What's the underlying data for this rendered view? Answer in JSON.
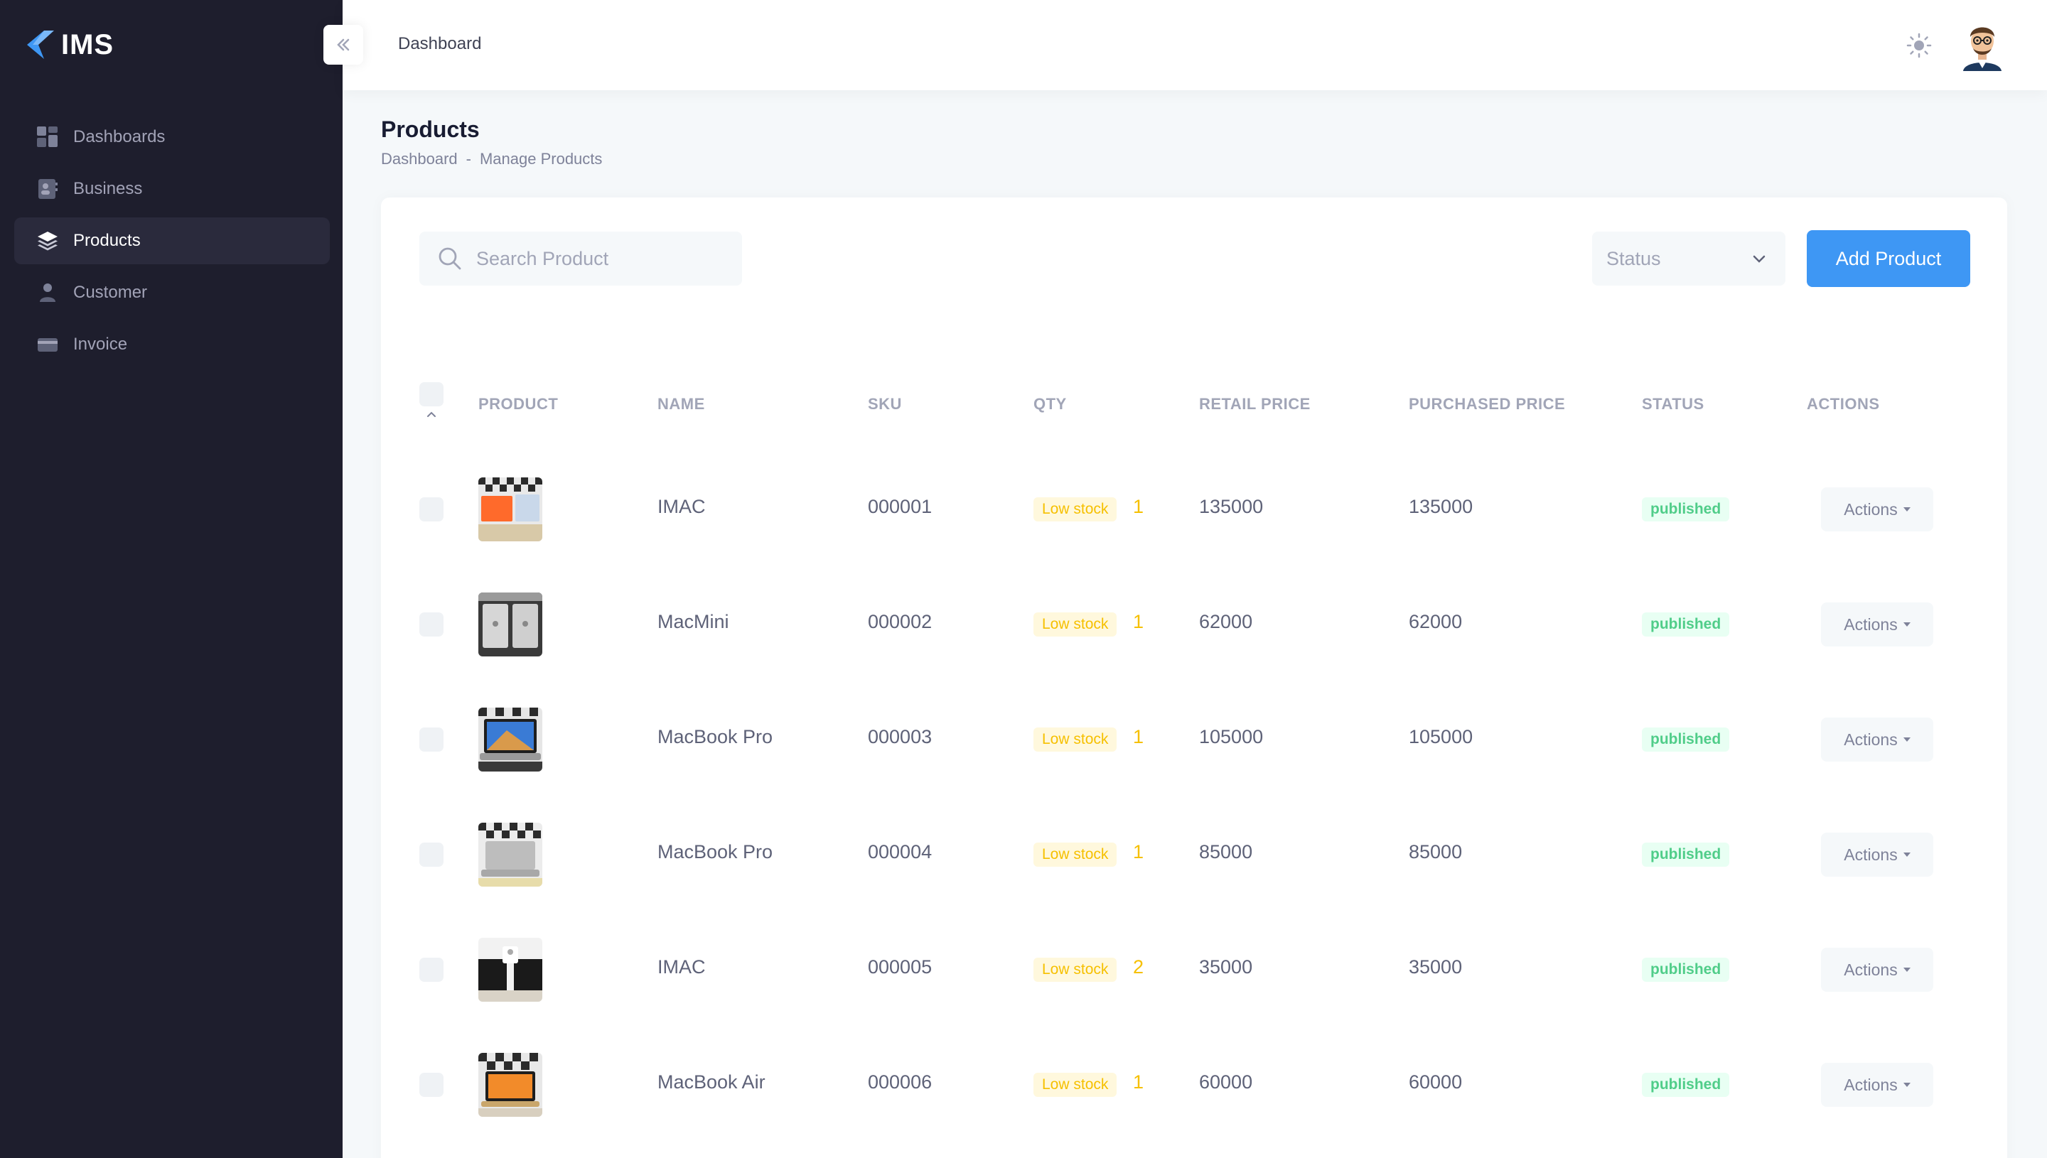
{
  "app": {
    "logo_text": "IMS"
  },
  "sidebar": {
    "items": [
      {
        "label": "Dashboards",
        "icon": "dashboard-icon",
        "active": false
      },
      {
        "label": "Business",
        "icon": "business-icon",
        "active": false
      },
      {
        "label": "Products",
        "icon": "layers-icon",
        "active": true
      },
      {
        "label": "Customer",
        "icon": "user-icon",
        "active": false
      },
      {
        "label": "Invoice",
        "icon": "credit-card-icon",
        "active": false
      }
    ]
  },
  "header": {
    "title": "Dashboard"
  },
  "page": {
    "title": "Products",
    "breadcrumb": [
      "Dashboard",
      "-",
      "Manage Products"
    ]
  },
  "toolbar": {
    "search_placeholder": "Search Product",
    "status_select": "Status",
    "add_button": "Add Product"
  },
  "table": {
    "columns": [
      "PRODUCT",
      "NAME",
      "SKU",
      "QTY",
      "RETAIL PRICE",
      "PURCHASED PRICE",
      "STATUS",
      "ACTIONS"
    ],
    "rows": [
      {
        "name": "IMAC",
        "sku": "000001",
        "stock_badge": "Low stock",
        "qty": "1",
        "retail": "135000",
        "purchased": "135000",
        "status": "published",
        "action": "Actions"
      },
      {
        "name": "MacMini",
        "sku": "000002",
        "stock_badge": "Low stock",
        "qty": "1",
        "retail": "62000",
        "purchased": "62000",
        "status": "published",
        "action": "Actions"
      },
      {
        "name": "MacBook Pro",
        "sku": "000003",
        "stock_badge": "Low stock",
        "qty": "1",
        "retail": "105000",
        "purchased": "105000",
        "status": "published",
        "action": "Actions"
      },
      {
        "name": "MacBook Pro",
        "sku": "000004",
        "stock_badge": "Low stock",
        "qty": "1",
        "retail": "85000",
        "purchased": "85000",
        "status": "published",
        "action": "Actions"
      },
      {
        "name": "IMAC",
        "sku": "000005",
        "stock_badge": "Low stock",
        "qty": "2",
        "retail": "35000",
        "purchased": "35000",
        "status": "published",
        "action": "Actions"
      },
      {
        "name": "MacBook Air",
        "sku": "000006",
        "stock_badge": "Low stock",
        "qty": "1",
        "retail": "60000",
        "purchased": "60000",
        "status": "published",
        "action": "Actions"
      }
    ]
  },
  "colors": {
    "sidebar_bg": "#1e1e2d",
    "primary": "#3e97f4",
    "warning": "#f6c000",
    "success": "#50cd89"
  }
}
